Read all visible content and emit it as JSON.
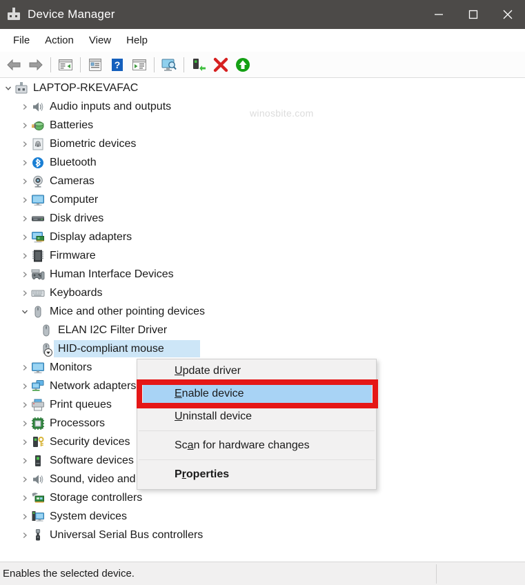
{
  "window": {
    "title": "Device Manager",
    "icon": "device-manager-icon",
    "titlebar_color": "#4c4a48",
    "controls": [
      {
        "name": "minimize-button",
        "glyph": "minimize"
      },
      {
        "name": "maximize-button",
        "glyph": "maximize"
      },
      {
        "name": "close-button",
        "glyph": "close"
      }
    ]
  },
  "menubar": {
    "items": [
      {
        "label": "File"
      },
      {
        "label": "Action"
      },
      {
        "label": "View"
      },
      {
        "label": "Help"
      }
    ]
  },
  "toolbar": {
    "buttons": [
      {
        "name": "back-button",
        "icon": "left-arrow-icon"
      },
      {
        "name": "forward-button",
        "icon": "right-arrow-icon"
      },
      {
        "name": "separator-1",
        "icon": "separator"
      },
      {
        "name": "show-hide-console-tree-button",
        "icon": "console-tree-icon"
      },
      {
        "name": "separator-2",
        "icon": "separator"
      },
      {
        "name": "properties-button",
        "icon": "properties-icon"
      },
      {
        "name": "help-button",
        "icon": "help-question-icon"
      },
      {
        "name": "show-hide-action-pane-button",
        "icon": "action-pane-icon"
      },
      {
        "name": "separator-3",
        "icon": "separator"
      },
      {
        "name": "scan-hardware-changes-button",
        "icon": "scan-monitor-icon"
      },
      {
        "name": "separator-4",
        "icon": "separator"
      },
      {
        "name": "update-driver-button",
        "icon": "update-driver-icon"
      },
      {
        "name": "uninstall-device-button",
        "icon": "red-x-icon"
      },
      {
        "name": "enable-device-button",
        "icon": "green-up-arrow-icon"
      }
    ]
  },
  "tree": {
    "root": {
      "label": "LAPTOP-RKEVAFAC",
      "icon": "computer-root-icon",
      "expanded": true,
      "chevron": "chevron-down"
    },
    "items": [
      {
        "label": "Audio inputs and outputs",
        "icon": "speaker-icon",
        "expanded": false
      },
      {
        "label": "Batteries",
        "icon": "battery-icon",
        "expanded": false
      },
      {
        "label": "Biometric devices",
        "icon": "fingerprint-icon",
        "expanded": false
      },
      {
        "label": "Bluetooth",
        "icon": "bluetooth-icon",
        "expanded": false
      },
      {
        "label": "Cameras",
        "icon": "camera-icon",
        "expanded": false
      },
      {
        "label": "Computer",
        "icon": "monitor-icon",
        "expanded": false
      },
      {
        "label": "Disk drives",
        "icon": "disk-drive-icon",
        "expanded": false
      },
      {
        "label": "Display adapters",
        "icon": "display-adapter-icon",
        "expanded": false
      },
      {
        "label": "Firmware",
        "icon": "firmware-chip-icon",
        "expanded": false
      },
      {
        "label": "Human Interface Devices",
        "icon": "gamepad-icon",
        "expanded": false
      },
      {
        "label": "Keyboards",
        "icon": "keyboard-icon",
        "expanded": false
      },
      {
        "label": "Mice and other pointing devices",
        "icon": "mouse-icon",
        "expanded": true
      },
      {
        "label": "Monitors",
        "icon": "monitor-icon",
        "expanded": false
      },
      {
        "label": "Network adapters",
        "icon": "network-adapter-icon",
        "expanded": false
      },
      {
        "label": "Print queues",
        "icon": "printer-icon",
        "expanded": false
      },
      {
        "label": "Processors",
        "icon": "processor-chip-icon",
        "expanded": false
      },
      {
        "label": "Security devices",
        "icon": "security-key-icon",
        "expanded": false
      },
      {
        "label": "Software devices",
        "icon": "software-device-icon",
        "expanded": false
      },
      {
        "label": "Sound, video and game controllers",
        "icon": "speaker-icon",
        "expanded": false
      },
      {
        "label": "Storage controllers",
        "icon": "storage-controller-icon",
        "expanded": false
      },
      {
        "label": "System devices",
        "icon": "system-device-icon",
        "expanded": false
      },
      {
        "label": "Universal Serial Bus controllers",
        "icon": "usb-icon",
        "expanded": false
      }
    ],
    "mice_children": [
      {
        "label": "ELAN I2C Filter Driver",
        "icon": "mouse-icon",
        "selected": false,
        "disabled": false
      },
      {
        "label": "HID-compliant mouse",
        "icon": "mouse-icon",
        "selected": true,
        "disabled": true
      }
    ],
    "selection_color": "#cde6f7"
  },
  "context_menu": {
    "items": [
      {
        "label": "Update driver",
        "accel_index": 1,
        "bold": false,
        "highlighted": false,
        "separator_after": false
      },
      {
        "label": "Enable device",
        "accel_index": 0,
        "bold": false,
        "highlighted": true,
        "separator_after": false
      },
      {
        "label": "Uninstall device",
        "accel_index": 0,
        "bold": false,
        "highlighted": false,
        "separator_after": true
      },
      {
        "label": "Scan for hardware changes",
        "accel_index": 3,
        "bold": false,
        "highlighted": false,
        "separator_after": true
      },
      {
        "label": "Properties",
        "accel_index": 1,
        "bold": true,
        "highlighted": false,
        "separator_after": false
      }
    ],
    "highlight_color": "#a8d3f5",
    "annotation_color": "#e51717"
  },
  "statusbar": {
    "text": "Enables the selected device."
  },
  "watermark": {
    "text": "winosbite.com"
  }
}
